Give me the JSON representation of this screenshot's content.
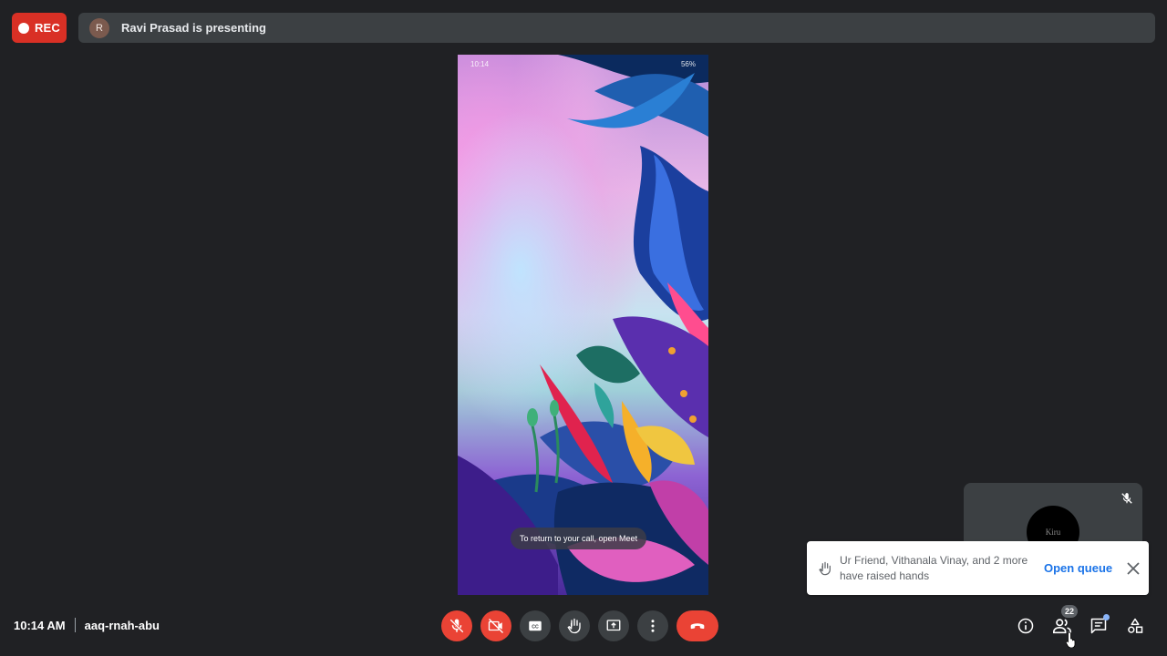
{
  "recording": {
    "label": "REC"
  },
  "presenter": {
    "initial": "R",
    "text": "Ravi Prasad is presenting"
  },
  "shared_screen": {
    "status_time": "10:14",
    "status_battery": "56%",
    "toast": "To return to your call, open Meet"
  },
  "self_view": {
    "avatar_text": "Kiru"
  },
  "notification": {
    "text": "Ur Friend, Vithanala Vinay, and 2 more have raised hands",
    "action": "Open queue"
  },
  "footer": {
    "time": "10:14 AM",
    "meeting_code": "aaq-rnah-abu"
  },
  "people": {
    "count": "22"
  },
  "colors": {
    "danger": "#ea4335",
    "link": "#1a73e8",
    "bg": "#202124",
    "surface": "#3c4043"
  },
  "icons": {
    "record": "record-dot-icon",
    "mic": "mic-off-icon",
    "cam": "camera-off-icon",
    "captions": "closed-captions-icon",
    "hand": "raise-hand-icon",
    "present": "present-screen-icon",
    "more": "more-options-icon",
    "end": "end-call-icon",
    "info": "info-icon",
    "people": "people-icon",
    "chat": "chat-icon",
    "activities": "activities-icon"
  }
}
